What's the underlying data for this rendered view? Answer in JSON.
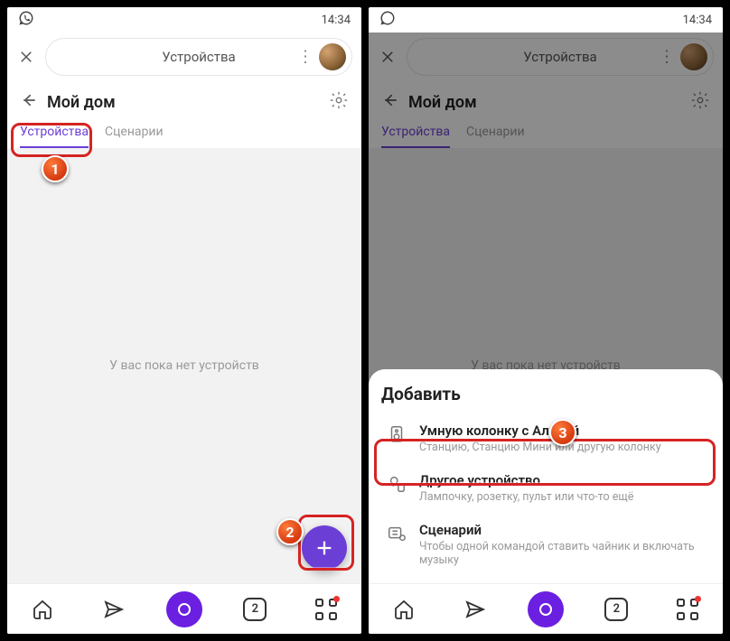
{
  "status": {
    "time": "14:34"
  },
  "search": {
    "title": "Устройства"
  },
  "header": {
    "title": "Мой дом"
  },
  "tabs": {
    "devices": "Устройства",
    "scenarios": "Сценарии"
  },
  "empty": {
    "message": "У вас пока нет устройств"
  },
  "nav": {
    "badge_count": "2"
  },
  "sheet": {
    "title": "Добавить",
    "items": [
      {
        "label": "Умную колонку с Алисой",
        "sub": "Станцию, Станцию Мини или другую колонку"
      },
      {
        "label": "Другое устройство",
        "sub": "Лампочку, розетку, пульт или что-то ещё"
      },
      {
        "label": "Сценарий",
        "sub": "Чтобы одной командой ставить чайник и включать музыку"
      }
    ]
  },
  "annotations": {
    "b1": "1",
    "b2": "2",
    "b3": "3"
  }
}
